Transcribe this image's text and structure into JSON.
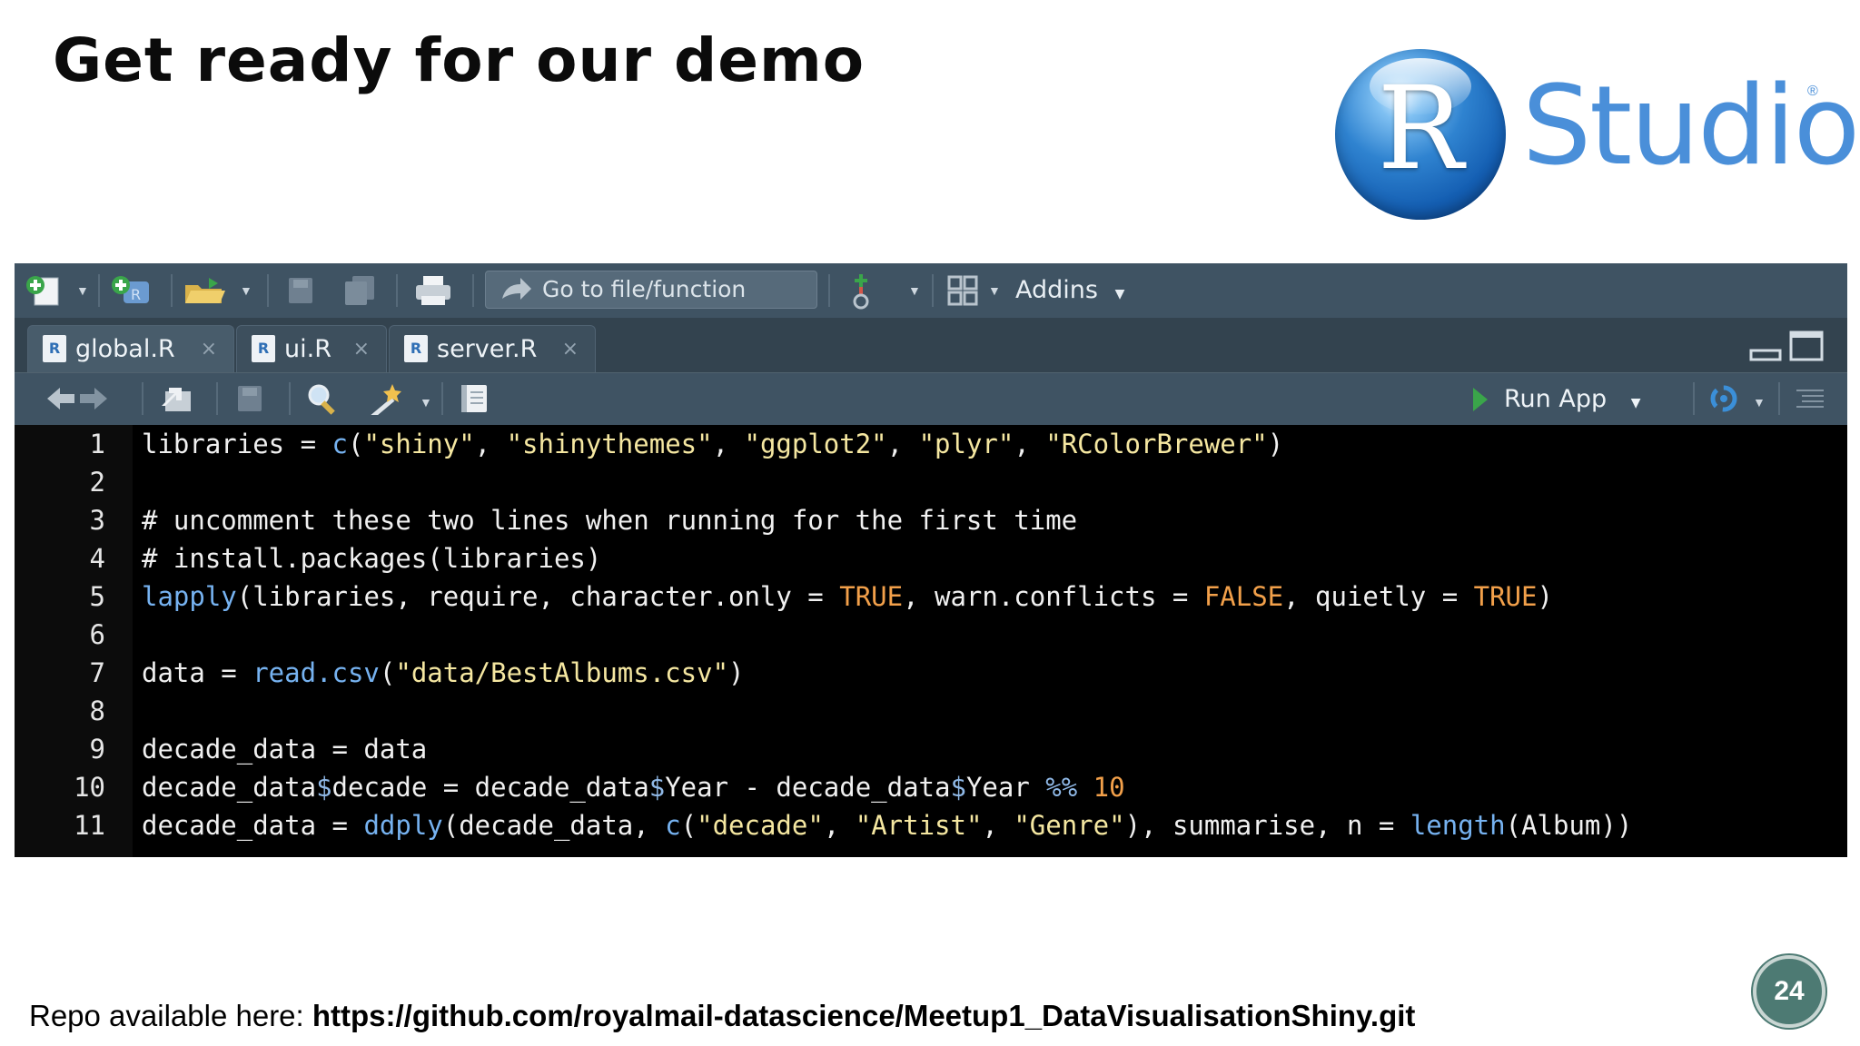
{
  "slide": {
    "title": "Get ready for our demo",
    "repo_prefix": "Repo available here: ",
    "repo_url": "https://github.com/royalmail-datascience/Meetup1_DataVisualisationShiny.git",
    "page_number": "24"
  },
  "logo": {
    "letter": "R",
    "word": "Studio",
    "reg": "®"
  },
  "toolbar": {
    "goto_placeholder": "Go to file/function",
    "addins_label": "Addins"
  },
  "tabs": [
    {
      "label": "global.R",
      "icon": "R",
      "close": "×"
    },
    {
      "label": "ui.R",
      "icon": "R",
      "close": "×"
    },
    {
      "label": "server.R",
      "icon": "R",
      "close": "×"
    }
  ],
  "editor_toolbar": {
    "run_app_label": "Run App"
  },
  "code": {
    "line_numbers": [
      "1",
      "2",
      "3",
      "4",
      "5",
      "6",
      "7",
      "8",
      "9",
      "10",
      "11"
    ],
    "l1": {
      "a": "libraries = ",
      "b": "c",
      "c": "(",
      "d": "\"shiny\"",
      "e": ", ",
      "f": "\"shinythemes\"",
      "g": ", ",
      "h": "\"ggplot2\"",
      "i": ", ",
      "j": "\"plyr\"",
      "k": ", ",
      "l": "\"RColorBrewer\"",
      "m": ")"
    },
    "l3": "# uncomment these two lines when running for the first time",
    "l4": "# install.packages(libraries)",
    "l5": {
      "a": "lapply",
      "b": "(libraries, require, character.only = ",
      "c": "TRUE",
      "d": ", warn.conflicts = ",
      "e": "FALSE",
      "f": ", quietly = ",
      "g": "TRUE",
      "h": ")"
    },
    "l7": {
      "a": "data = ",
      "b": "read.csv",
      "c": "(",
      "d": "\"data/BestAlbums.csv\"",
      "e": ")"
    },
    "l9": "decade_data = data",
    "l10": {
      "a": "decade_data",
      "b": "$",
      "c": "decade = decade_data",
      "d": "$",
      "e": "Year - decade_data",
      "f": "$",
      "g": "Year ",
      "h": "%%",
      "i": " ",
      "j": "10"
    },
    "l11": {
      "a": "decade_data = ",
      "b": "ddply",
      "c": "(decade_data, ",
      "d": "c",
      "e": "(",
      "f": "\"decade\"",
      "g": ", ",
      "h": "\"Artist\"",
      "i": ", ",
      "j": "\"Genre\"",
      "k": "), summarise, n = ",
      "l": "length",
      "m": "(Album))"
    }
  }
}
